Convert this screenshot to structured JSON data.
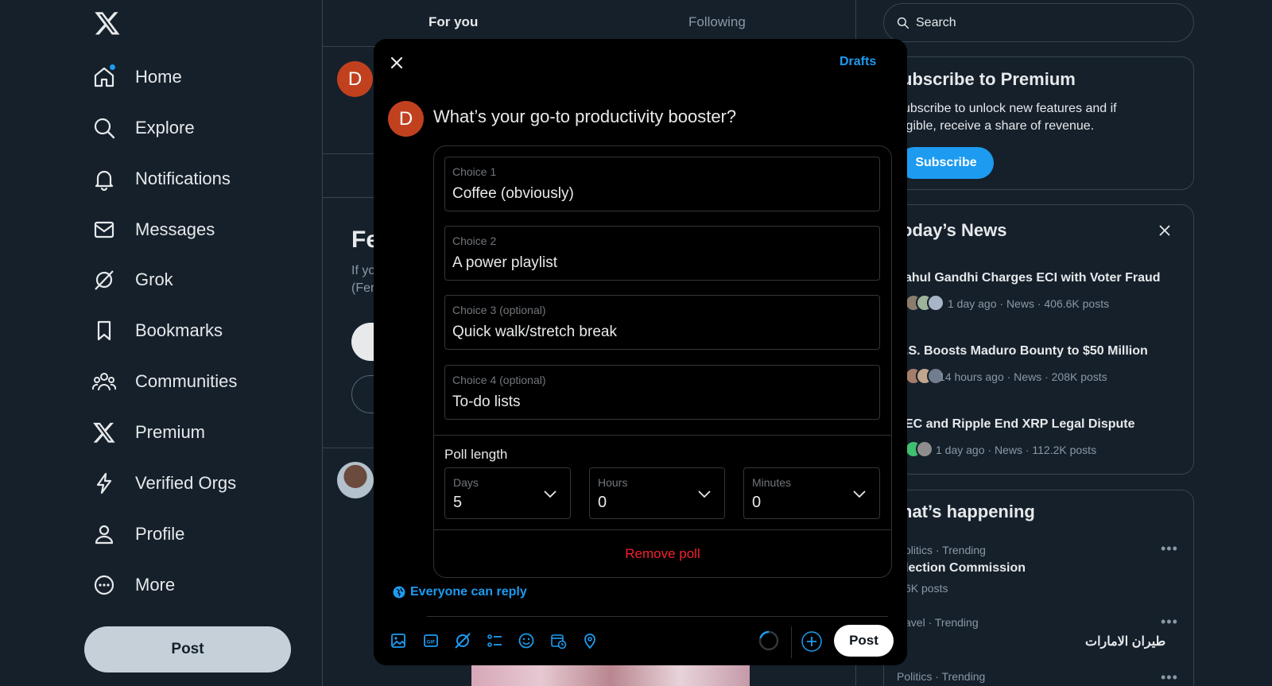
{
  "sidebar": {
    "items": [
      {
        "label": "Home",
        "icon": "home-icon"
      },
      {
        "label": "Explore",
        "icon": "search-icon"
      },
      {
        "label": "Notifications",
        "icon": "bell-icon"
      },
      {
        "label": "Messages",
        "icon": "mail-icon"
      },
      {
        "label": "Grok",
        "icon": "grok-icon"
      },
      {
        "label": "Bookmarks",
        "icon": "bookmark-icon"
      },
      {
        "label": "Communities",
        "icon": "communities-icon"
      },
      {
        "label": "Premium",
        "icon": "x-logo-icon"
      },
      {
        "label": "Verified Orgs",
        "icon": "lightning-icon"
      },
      {
        "label": "Profile",
        "icon": "person-icon"
      },
      {
        "label": "More",
        "icon": "more-circle-icon"
      }
    ],
    "post_label": "Post"
  },
  "feed": {
    "tabs": [
      "For you",
      "Following"
    ],
    "avatar_initial": "D",
    "bg_heading": "Fe",
    "bg_line1": "If yo",
    "bg_line2": "(Fer"
  },
  "right": {
    "search_placeholder": "Search",
    "premium": {
      "title": "ubscribe to Premium",
      "line1": "ubscribe to unlock new features and if",
      "line2": "igible, receive a share of revenue.",
      "button": "Subscribe"
    },
    "news": {
      "title": "oday’s News",
      "items": [
        {
          "title": "ahul Gandhi Charges ECI with Voter Fraud",
          "meta": "1 day ago · News · 406.6K posts"
        },
        {
          "title": ".S. Boosts Maduro Bounty to $50 Million",
          "meta": "14 hours ago · News · 208K posts"
        },
        {
          "title": "EC and Ripple End XRP Legal Dispute",
          "meta": "1 day ago · News · 112.2K posts"
        }
      ]
    },
    "happening": {
      "title": "hat’s happening",
      "trends": [
        {
          "meta": "olitics · Trending",
          "name": "lection Commission",
          "count": "6K posts"
        },
        {
          "meta": "avel · Trending",
          "name": "طيران الامارات"
        },
        {
          "meta": "Politics · Trending"
        }
      ]
    }
  },
  "modal": {
    "drafts": "Drafts",
    "avatar_initial": "D",
    "question": "What’s your go-to productivity booster?",
    "choices": [
      {
        "label": "Choice 1",
        "value": "Coffee (obviously)"
      },
      {
        "label": "Choice 2",
        "value": "A power playlist"
      },
      {
        "label": "Choice 3 (optional)",
        "value": "Quick walk/stretch break"
      },
      {
        "label": "Choice 4 (optional)",
        "value": "To-do lists"
      }
    ],
    "poll_length_label": "Poll length",
    "days": {
      "label": "Days",
      "value": "5"
    },
    "hours": {
      "label": "Hours",
      "value": "0"
    },
    "minutes": {
      "label": "Minutes",
      "value": "0"
    },
    "remove_poll": "Remove poll",
    "reply_setting": "Everyone can reply",
    "post_label": "Post",
    "toolbar_icons": [
      "image-icon",
      "gif-icon",
      "grok-icon",
      "poll-icon",
      "emoji-icon",
      "schedule-icon",
      "location-icon"
    ]
  },
  "colors": {
    "background": "#15202b",
    "accent": "#1d9bf0",
    "danger": "#f4212e",
    "avatar": "#c1411f"
  }
}
